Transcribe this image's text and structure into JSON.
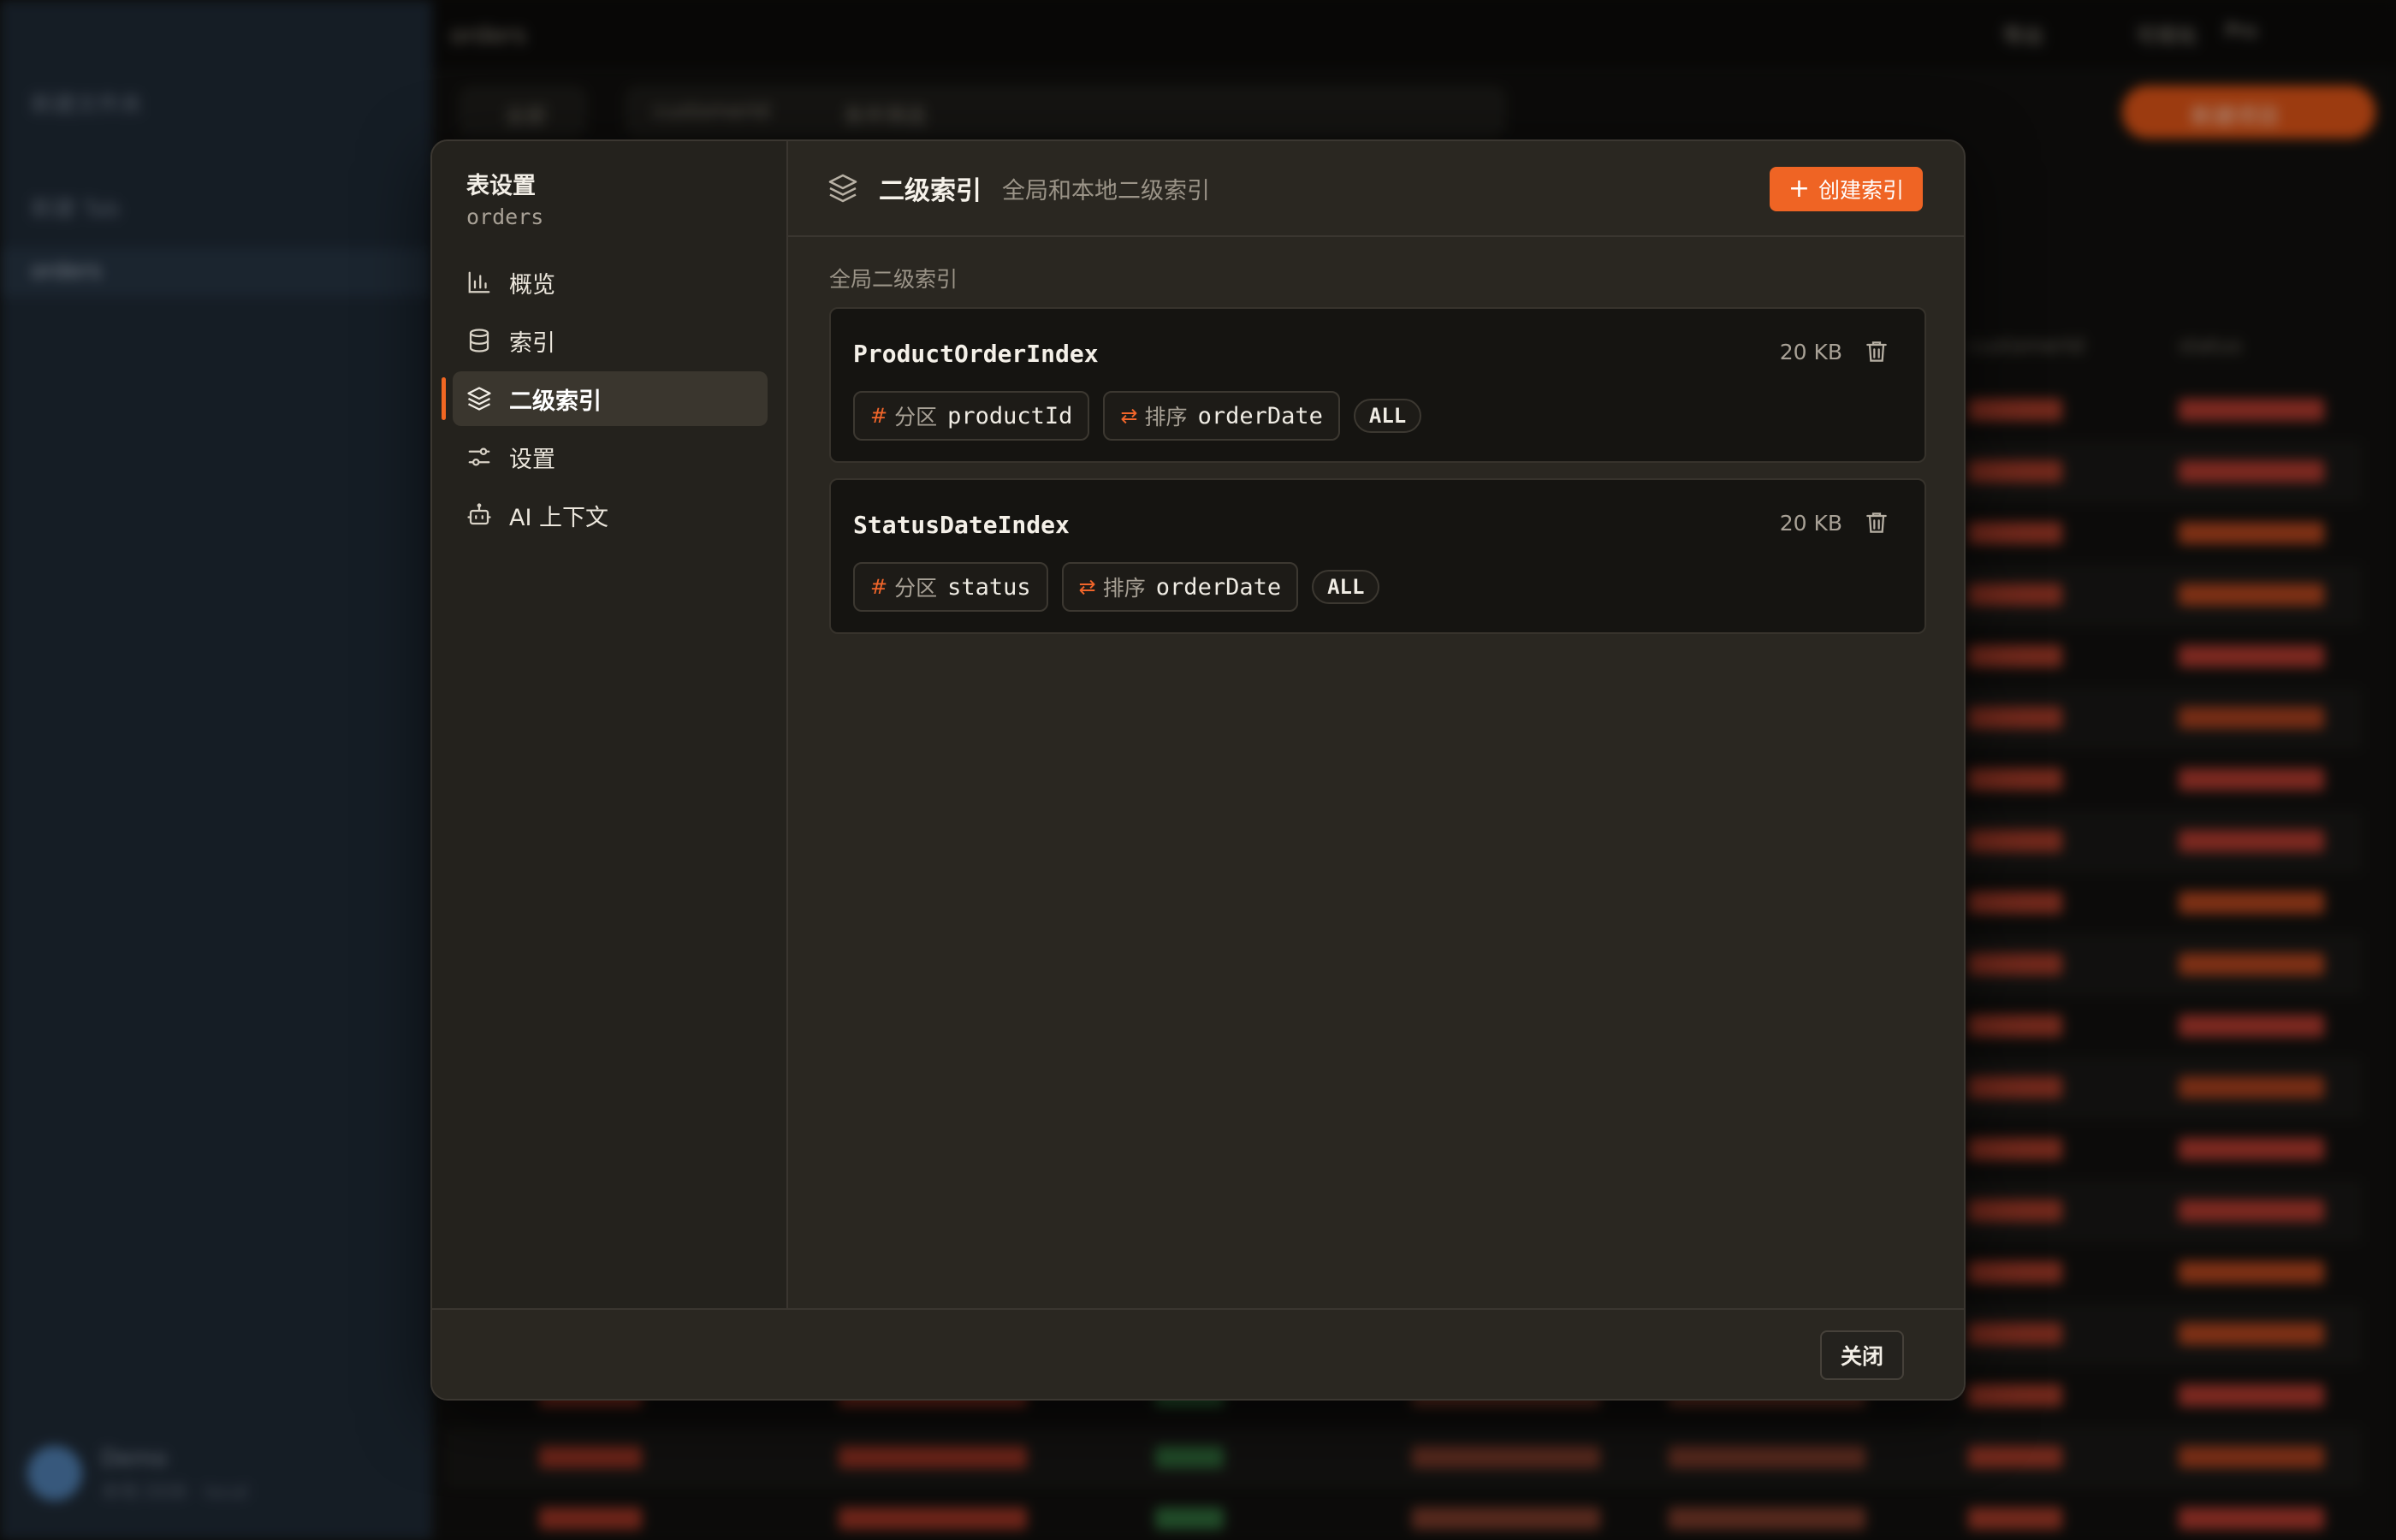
{
  "background": {
    "sidebar_items": [
      "新建文件夹",
      "新建 Tab",
      "orders"
    ],
    "user_name": "Demo",
    "user_sub": "本地 DDB · local",
    "window_title": "orders",
    "top_right": [
      "导出",
      "可视化",
      "Pro"
    ],
    "toolbar": [
      "全部",
      "customerId",
      "条件筛选"
    ],
    "primary_action": "新建项目",
    "column_headers": [
      "customerId",
      "status"
    ]
  },
  "dialog": {
    "title": "表设置",
    "table_name": "orders",
    "nav": [
      {
        "label": "概览",
        "icon": "bar-chart-icon"
      },
      {
        "label": "索引",
        "icon": "database-icon"
      },
      {
        "label": "二级索引",
        "icon": "layers-icon",
        "active": true
      },
      {
        "label": "设置",
        "icon": "sliders-icon"
      },
      {
        "label": "AI 上下文",
        "icon": "robot-icon"
      }
    ],
    "header": {
      "title": "二级索引",
      "description": "全局和本地二级索引",
      "create_label": "创建索引"
    },
    "section_label": "全局二级索引",
    "indexes": [
      {
        "name": "ProductOrderIndex",
        "size": "20 KB",
        "partition_label": "分区",
        "partition_key": "productId",
        "sort_label": "排序",
        "sort_key": "orderDate",
        "projection": "ALL"
      },
      {
        "name": "StatusDateIndex",
        "size": "20 KB",
        "partition_label": "分区",
        "partition_key": "status",
        "sort_label": "排序",
        "sort_key": "orderDate",
        "projection": "ALL"
      }
    ],
    "close_label": "关闭"
  },
  "colors": {
    "accent": "#ef6424",
    "dialog_bg": "#2a2721",
    "card_bg": "#151411"
  }
}
